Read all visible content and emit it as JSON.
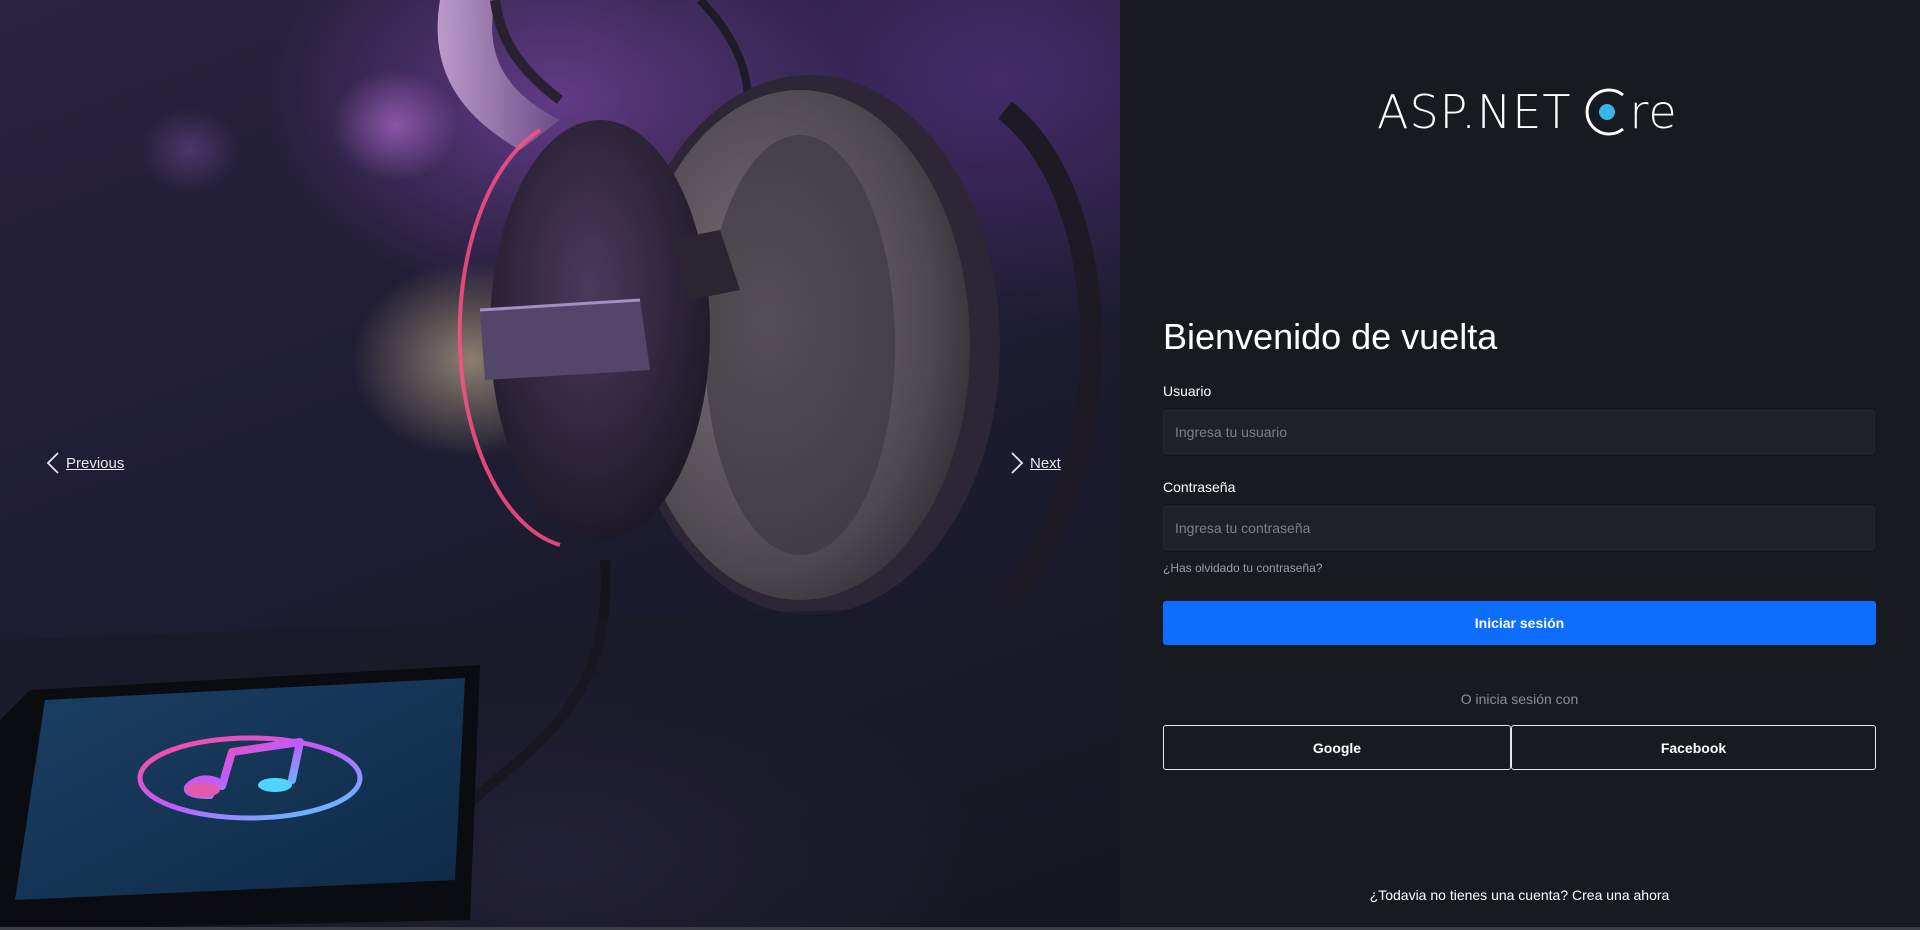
{
  "carousel": {
    "prev_label": "Previous",
    "next_label": "Next",
    "slide_image": "headphones-and-phone-music-photo"
  },
  "brand": {
    "logo_text_main": "ASP.NET ",
    "logo_text_end": "re"
  },
  "login": {
    "title": "Bienvenido de vuelta",
    "username_label": "Usuario",
    "username_placeholder": "Ingresa tu usuario",
    "password_label": "Contraseña",
    "password_placeholder": "Ingresa tu contraseña",
    "forgot_link": "¿Has olvidado tu contraseña?",
    "submit_label": "Iniciar sesión",
    "alt_login_text": "O inicia sesión con",
    "google_label": "Google",
    "facebook_label": "Facebook",
    "signup_prompt": "¿Todavia no tienes una cuenta?",
    "signup_link": "Crea una ahora"
  },
  "colors": {
    "panel_bg": "#171a1e",
    "primary": "#0d6efd",
    "logo_accent": "#38b6e8"
  }
}
